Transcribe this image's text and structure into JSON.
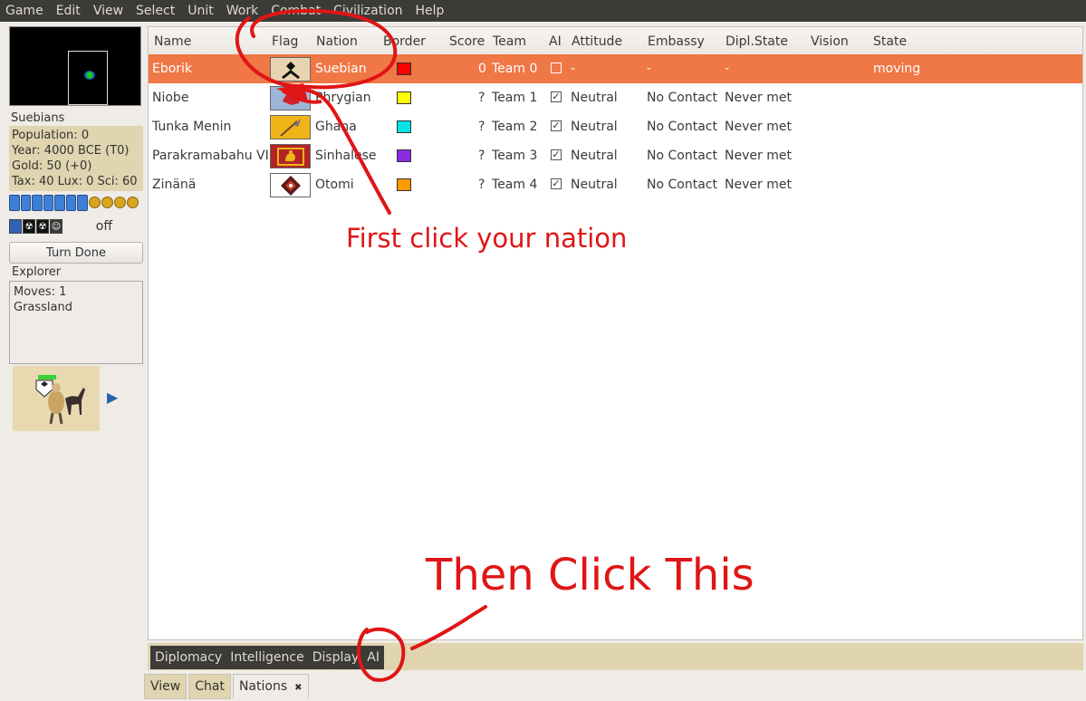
{
  "menu": [
    "Game",
    "Edit",
    "View",
    "Select",
    "Unit",
    "Work",
    "Combat",
    "Civilization",
    "Help"
  ],
  "civ": {
    "name": "Suebians",
    "population": "Population: 0",
    "year": "Year: 4000 BCE (T0)",
    "gold": "Gold: 50 (+0)",
    "rates": "Tax: 40 Lux: 0 Sci: 60",
    "status_off": "off",
    "turn_done": "Turn Done"
  },
  "unit": {
    "title": "Explorer",
    "moves": "Moves: 1",
    "terrain": "Grassland"
  },
  "table": {
    "headers": {
      "name": "Name",
      "flag": "Flag",
      "nation": "Nation",
      "border": "Border",
      "score": "Score",
      "team": "Team",
      "ai": "AI",
      "attitude": "Attitude",
      "embassy": "Embassy",
      "dipl_state": "Dipl.State",
      "vision": "Vision",
      "state": "State"
    },
    "rows": [
      {
        "name": "Eborik",
        "nation": "Suebian",
        "border": "#ff0000",
        "score": "0",
        "team": "Team 0",
        "ai": false,
        "attitude": "-",
        "embassy": "-",
        "dipl_state": "-",
        "vision": "",
        "state": "moving",
        "flag_bg": "#e8d4b0"
      },
      {
        "name": "Niobe",
        "nation": "Phrygian",
        "border": "#ffff00",
        "score": "?",
        "team": "Team 1",
        "ai": true,
        "attitude": "Neutral",
        "embassy": "No Contact",
        "dipl_state": "Never met",
        "vision": "",
        "state": "",
        "flag_bg": "#9db6d8"
      },
      {
        "name": "Tunka Menin",
        "nation": "Ghana",
        "border": "#00e5e5",
        "score": "?",
        "team": "Team 2",
        "ai": true,
        "attitude": "Neutral",
        "embassy": "No Contact",
        "dipl_state": "Never met",
        "vision": "",
        "state": "",
        "flag_bg": "#f0b419"
      },
      {
        "name": "Parakramabahu VI",
        "nation": "Sinhalese",
        "border": "#8b2be2",
        "score": "?",
        "team": "Team 3",
        "ai": true,
        "attitude": "Neutral",
        "embassy": "No Contact",
        "dipl_state": "Never met",
        "vision": "",
        "state": "",
        "flag_bg": "#b32424"
      },
      {
        "name": "Zinänä",
        "nation": "Otomi",
        "border": "#ff9900",
        "score": "?",
        "team": "Team 4",
        "ai": true,
        "attitude": "Neutral",
        "embassy": "No Contact",
        "dipl_state": "Never met",
        "vision": "",
        "state": "",
        "flag_bg": "#ffffff"
      }
    ]
  },
  "sub_tabs": [
    "Diplomacy",
    "Intelligence",
    "Display",
    "AI"
  ],
  "bottom_tabs": [
    "View",
    "Chat",
    "Nations"
  ],
  "annotations": {
    "first": "First click your nation",
    "then": "Then Click This"
  }
}
